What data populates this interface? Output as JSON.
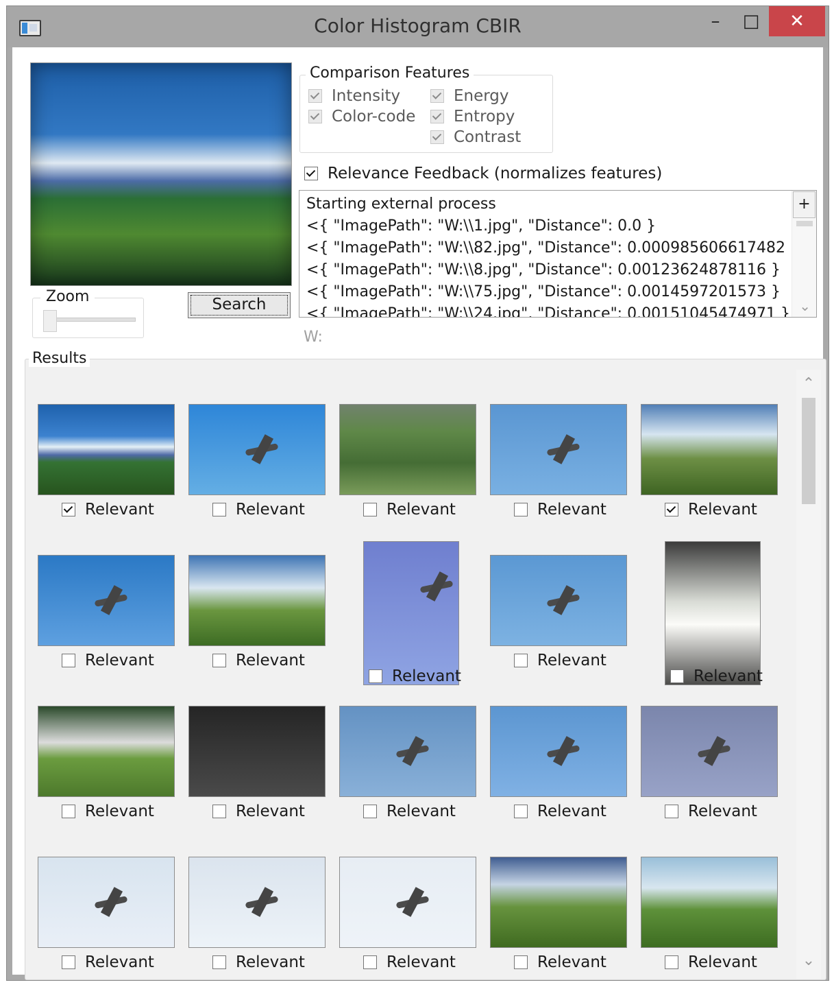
{
  "window": {
    "title": "Color Histogram CBIR"
  },
  "titlebar": {
    "minimize": "–",
    "maximize": "□",
    "close": "✕"
  },
  "controls": {
    "zoom_label": "Zoom",
    "search_button": "Search"
  },
  "features": {
    "group_title": "Comparison Features",
    "items": [
      "Intensity",
      "Color-code",
      "Energy",
      "Entropy",
      "Contrast"
    ]
  },
  "relevance_feedback": {
    "label": "Relevance Feedback (normalizes features)",
    "checked": true
  },
  "log": {
    "plus_label": "+",
    "lines": [
      "Starting external process",
      "<{ \"ImagePath\": \"W:\\\\1.jpg\", \"Distance\": 0.0 }",
      "<{ \"ImagePath\": \"W:\\\\82.jpg\", \"Distance\": 0.000985606617482 }",
      "<{ \"ImagePath\": \"W:\\\\8.jpg\", \"Distance\": 0.00123624878116 }",
      "<{ \"ImagePath\": \"W:\\\\75.jpg\", \"Distance\": 0.0014597201573 }",
      "<{ \"ImagePath\": \"W:\\\\24.jpg\", \"Distance\": 0.00151045474971 }"
    ]
  },
  "w_label": "W:",
  "results": {
    "title": "Results",
    "relevant_label": "Relevant",
    "checked": [
      true,
      false,
      false,
      false,
      true,
      false,
      false,
      false,
      false,
      false,
      false,
      false,
      false,
      false,
      false,
      false,
      false,
      false,
      false,
      false
    ],
    "scroll_up": "⌃",
    "scroll_down": "⌄"
  },
  "icons": {
    "app": "window-icon",
    "minimize": "minimize-icon",
    "maximize": "maximize-icon",
    "close": "close-icon"
  },
  "colors": {
    "title_bar": "#a7a7a7",
    "close_button": "#c9454a",
    "results_background": "#f1f1f1"
  }
}
